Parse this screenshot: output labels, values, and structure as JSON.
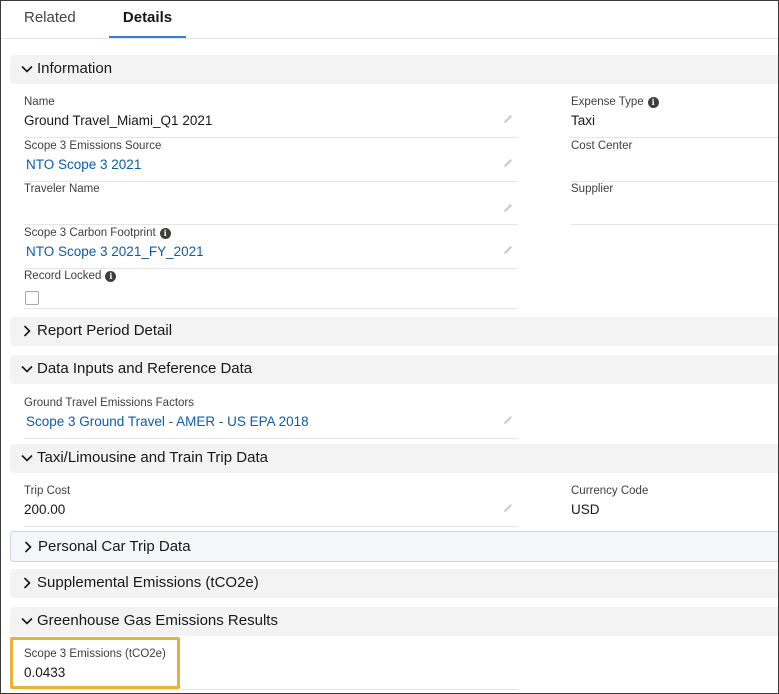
{
  "tabs": {
    "related": "Related",
    "details": "Details"
  },
  "sections": {
    "information": "Information",
    "report_period": "Report Period Detail",
    "data_inputs": "Data Inputs and Reference Data",
    "taxi": "Taxi/Limousine and Train Trip Data",
    "personal_car": "Personal Car Trip Data",
    "supplemental": "Supplemental Emissions (tCO2e)",
    "ghg_results": "Greenhouse Gas Emissions Results"
  },
  "fields": {
    "name": {
      "label": "Name",
      "value": "Ground Travel_Miami_Q1 2021"
    },
    "expense_type": {
      "label": "Expense Type",
      "value": "Taxi"
    },
    "emissions_source": {
      "label": "Scope 3 Emissions Source",
      "value": "NTO Scope 3 2021"
    },
    "cost_center": {
      "label": "Cost Center",
      "value": ""
    },
    "traveler_name": {
      "label": "Traveler Name",
      "value": ""
    },
    "supplier": {
      "label": "Supplier",
      "value": ""
    },
    "carbon_footprint": {
      "label": "Scope 3 Carbon Footprint",
      "value": "NTO Scope 3 2021_FY_2021"
    },
    "record_locked": {
      "label": "Record Locked",
      "checked": false
    },
    "emissions_factors": {
      "label": "Ground Travel Emissions Factors",
      "value": "Scope 3 Ground Travel - AMER - US EPA 2018"
    },
    "trip_cost": {
      "label": "Trip Cost",
      "value": "200.00"
    },
    "currency_code": {
      "label": "Currency Code",
      "value": "USD"
    },
    "scope3_emissions": {
      "label": "Scope 3 Emissions (tCO2e)",
      "value": "0.0433"
    }
  },
  "colors": {
    "link": "#0b5cab",
    "tab_underline": "#3a7bd5",
    "highlight": "#e8b23a"
  },
  "icons": {
    "expanded": "chevron-down-icon",
    "collapsed": "chevron-right-icon",
    "edit": "pencil-icon",
    "info": "info-icon"
  }
}
